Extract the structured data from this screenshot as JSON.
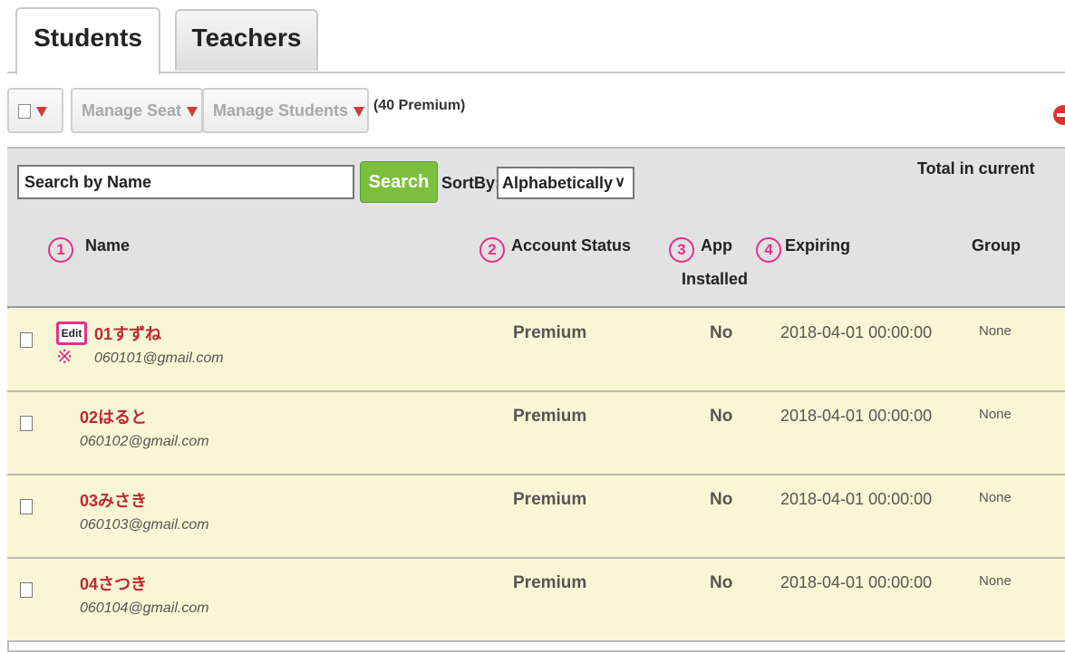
{
  "tabs": [
    {
      "label": "Students",
      "active": true
    },
    {
      "label": "Teachers",
      "active": false
    }
  ],
  "toolbar": {
    "manage_seat": "Manage Seat",
    "manage_students": "Manage Students",
    "premium_count": "(40 Premium)"
  },
  "search": {
    "placeholder": "Search by Name",
    "button": "Search",
    "sortby_label": "SortBy:",
    "sort_value": "Alphabetically",
    "total_label": "Total in current"
  },
  "annotations": {
    "c1": "1",
    "c2": "2",
    "c3": "3",
    "c4": "4",
    "note_mark": "※"
  },
  "columns": {
    "name": "Name",
    "status": "Account Status",
    "app_1": "App",
    "app_2": "Installed",
    "expiring": "Expiring",
    "group": "Group"
  },
  "edit_label": "Edit",
  "rows": [
    {
      "name": "01すずね",
      "email": "060101@gmail.com",
      "status": "Premium",
      "app": "No",
      "expiring": "2018-04-01 00:00:00",
      "group": "None"
    },
    {
      "name": "02はると",
      "email": "060102@gmail.com",
      "status": "Premium",
      "app": "No",
      "expiring": "2018-04-01 00:00:00",
      "group": "None"
    },
    {
      "name": "03みさき",
      "email": "060103@gmail.com",
      "status": "Premium",
      "app": "No",
      "expiring": "2018-04-01 00:00:00",
      "group": "None"
    },
    {
      "name": "04さつき",
      "email": "060104@gmail.com",
      "status": "Premium",
      "app": "No",
      "expiring": "2018-04-01 00:00:00",
      "group": "None"
    }
  ],
  "colors": {
    "accent_pink": "#e4308b",
    "name_red": "#c0272d",
    "search_green": "#7cbf3f",
    "row_bg": "#f7f7d6"
  }
}
